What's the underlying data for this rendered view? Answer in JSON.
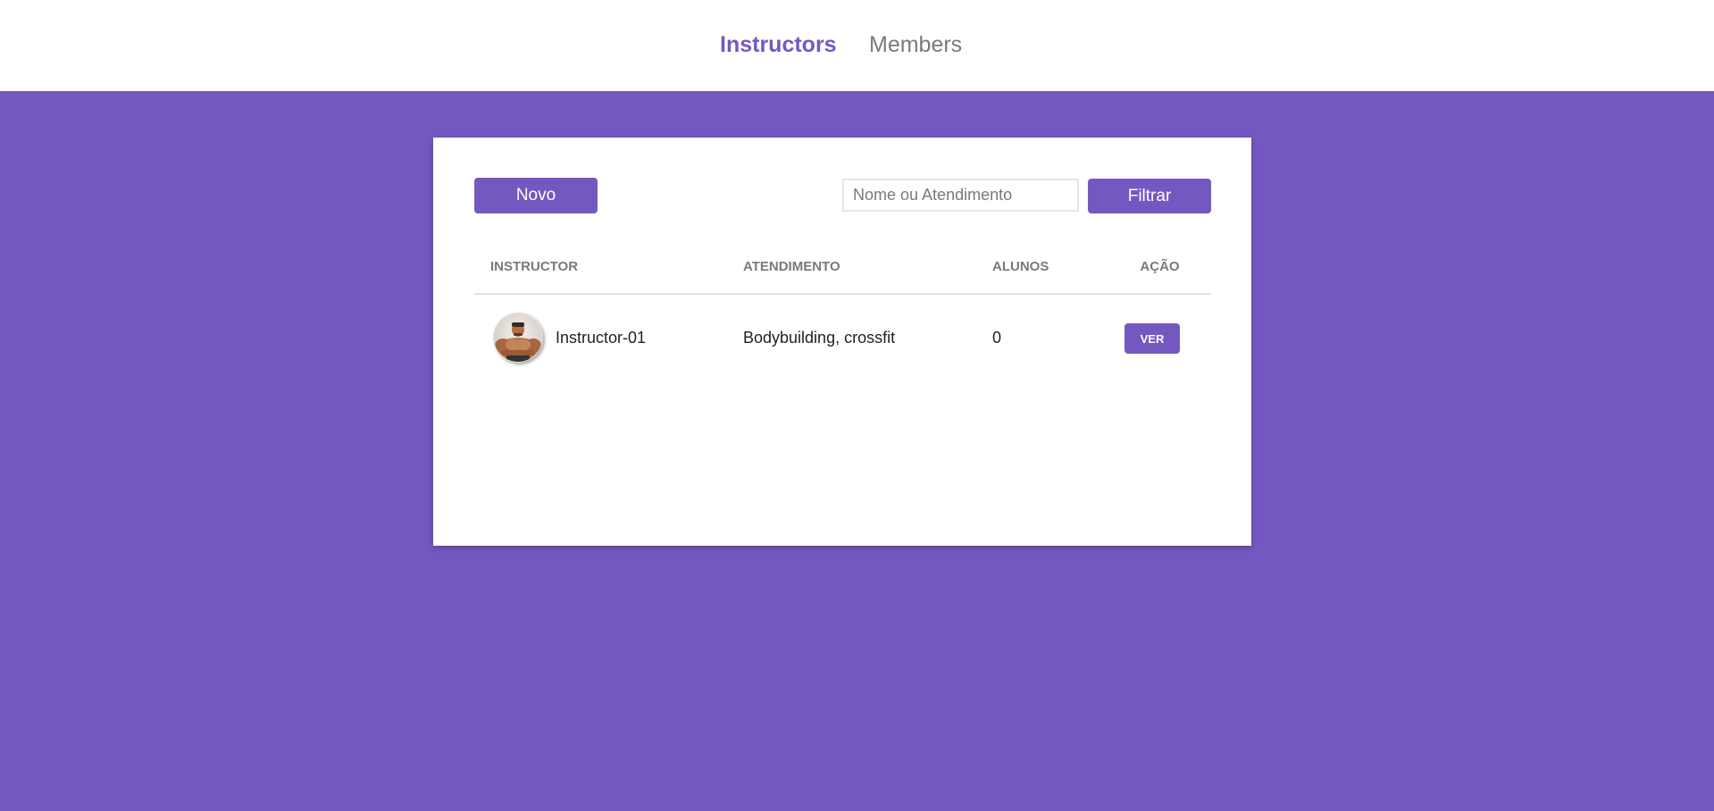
{
  "nav": {
    "instructors": "Instructors",
    "members": "Members"
  },
  "toolbar": {
    "new_label": "Novo",
    "search_placeholder": "Nome ou Atendimento",
    "search_value": "",
    "filter_label": "Filtrar"
  },
  "table": {
    "headers": [
      "INSTRUCTOR",
      "ATENDIMENTO",
      "ALUNOS",
      "AÇÃO"
    ],
    "rows": [
      {
        "name": "Instructor-01",
        "atendimento": "Bodybuilding, crossfit",
        "alunos": "0",
        "action_label": "VER"
      }
    ]
  },
  "colors": {
    "accent": "#7458c1",
    "background": "#7458c1",
    "nav_inactive": "#7a7a7a"
  },
  "icons": {
    "avatar": "instructor-avatar-image"
  }
}
